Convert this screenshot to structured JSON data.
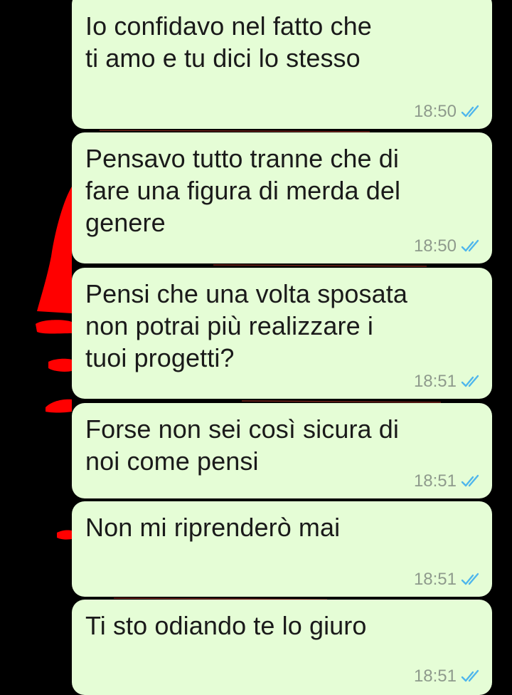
{
  "colors": {
    "bubble_background": "#e5fdd6",
    "message_text": "#1a1a1a",
    "timestamp": "#8e9a8c",
    "read_ticks": "#4fb6ec",
    "wallpaper": "#000000",
    "wallpaper_art": "#ff0000"
  },
  "messages": [
    {
      "text": "Io confidavo nel fatto che\nti amo e tu dici lo stesso",
      "time": "18:50",
      "status_icon": "double-check-read-icon"
    },
    {
      "text": "Pensavo tutto tranne che di\nfare una figura di merda del\ngenere",
      "time": "18:50",
      "status_icon": "double-check-read-icon"
    },
    {
      "text": "Pensi che una volta sposata\nnon potrai più realizzare i\ntuoi progetti?",
      "time": "18:51",
      "status_icon": "double-check-read-icon"
    },
    {
      "text": "Forse non sei così sicura di\nnoi come pensi",
      "time": "18:51",
      "status_icon": "double-check-read-icon"
    },
    {
      "text": "Non mi riprenderò mai",
      "time": "18:51",
      "status_icon": "double-check-read-icon"
    },
    {
      "text": "Ti sto odiando te lo giuro",
      "time": "18:51",
      "status_icon": "double-check-read-icon"
    }
  ]
}
